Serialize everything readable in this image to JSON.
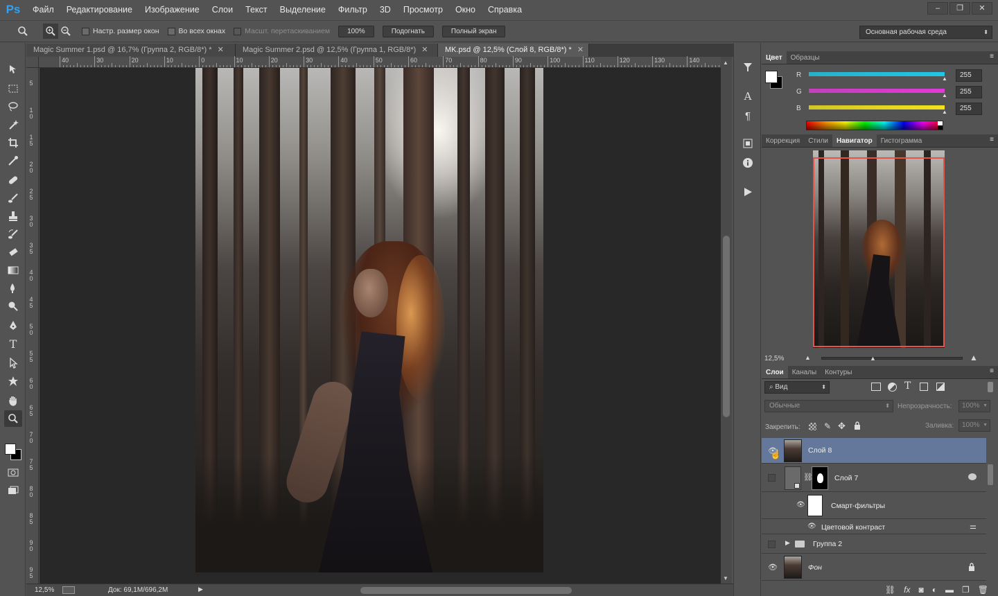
{
  "app": {
    "logo": "Ps"
  },
  "menu": [
    "Файл",
    "Редактирование",
    "Изображение",
    "Слои",
    "Текст",
    "Выделение",
    "Фильтр",
    "3D",
    "Просмотр",
    "Окно",
    "Справка"
  ],
  "window_controls": [
    "–",
    "❐",
    "✕"
  ],
  "options": {
    "resize_windows": "Настр. размер окон",
    "all_windows": "Во всех окнах",
    "scrubby_zoom": "Масшт. перетаскиванием",
    "zoom_btn": "100%",
    "fit_btn": "Подогнать",
    "fullscreen_btn": "Полный экран",
    "workspace": "Основная рабочая среда"
  },
  "tabs": [
    {
      "label": "Magic Summer 1.psd @ 16,7% (Группа 2, RGB/8*) *",
      "close": "✕"
    },
    {
      "label": "Magic Summer 2.psd @ 12,5% (Группа 1, RGB/8*)",
      "close": "✕"
    },
    {
      "label": "MK.psd @ 12,5% (Слой 8, RGB/8*) *",
      "close": "✕"
    }
  ],
  "ruler_h": [
    "40",
    "30",
    "20",
    "10",
    "0",
    "10",
    "20",
    "30",
    "40",
    "50",
    "60",
    "70",
    "80",
    "90",
    "100",
    "110",
    "120",
    "130",
    "140"
  ],
  "ruler_v": [
    "5",
    "10",
    "15",
    "20",
    "25",
    "30",
    "35",
    "40",
    "45",
    "50",
    "55",
    "60",
    "65",
    "70",
    "75",
    "80",
    "85",
    "90",
    "95"
  ],
  "status": {
    "zoom": "12,5%",
    "doc": "Док: 69,1M/696,2M"
  },
  "color_panel": {
    "tabs": [
      "Цвет",
      "Образцы"
    ],
    "r_label": "R",
    "g_label": "G",
    "b_label": "B",
    "r": "255",
    "g": "255",
    "b": "255",
    "r_color": "#1fc7e6",
    "g_color": "#e13ad8",
    "b_color": "#f1e21b"
  },
  "nav_panel": {
    "tabs": [
      "Коррекция",
      "Стили",
      "Навигатор",
      "Гистограмма"
    ],
    "zoom": "12,5%",
    "view_rect_color": "#e0564b"
  },
  "layers_panel": {
    "tabs": [
      "Слои",
      "Каналы",
      "Контуры"
    ],
    "filter": "Вид",
    "blend": "Обычные",
    "opacity_label": "Непрозрачность:",
    "opacity": "100%",
    "lock_label": "Закрепить:",
    "fill_label": "Заливка:",
    "fill": "100%",
    "layers": [
      "Слой 8",
      "Слой 7",
      "Смарт-фильтры",
      "Цветовой контраст",
      "Группа 2",
      "Фон"
    ],
    "selected_color": "#63789b"
  }
}
